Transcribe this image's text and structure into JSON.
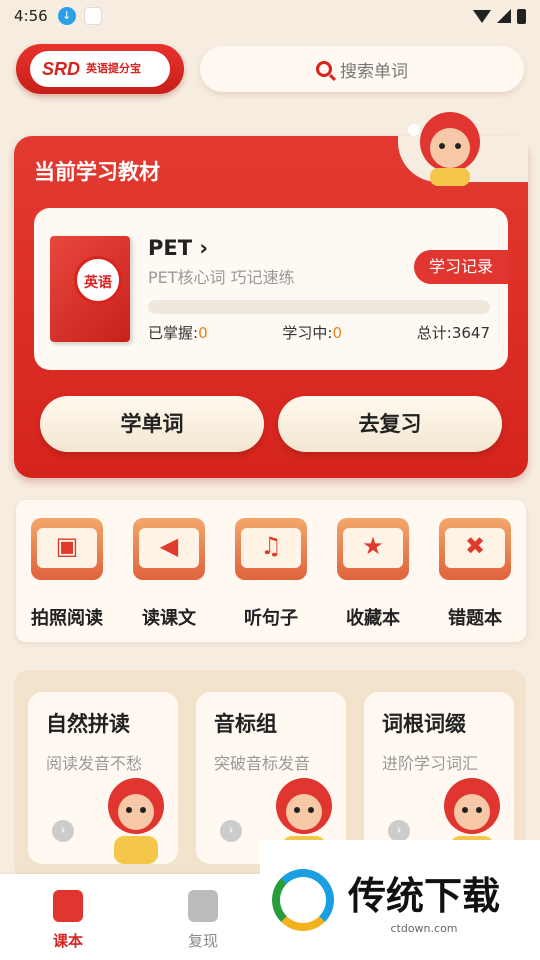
{
  "status": {
    "time": "4:56"
  },
  "logo": {
    "brand": "SRD",
    "name": "英语提分宝"
  },
  "search": {
    "placeholder": "搜索单词"
  },
  "study": {
    "title": "当前学习教材",
    "book_cover_badge": "英语",
    "book_name": "PET",
    "book_desc": "PET核心词 巧记速练",
    "record_button": "学习记录",
    "mastered_label": "已掌握:",
    "mastered_value": "0",
    "learning_label": "学习中:",
    "learning_value": "0",
    "total_label": "总计:",
    "total_value": "3647",
    "progress_fraction": 0
  },
  "buttons": {
    "study": "学单词",
    "review": "去复习"
  },
  "features": [
    {
      "label": "拍照阅读",
      "icon": "camera-icon"
    },
    {
      "label": "读课文",
      "icon": "megaphone-icon"
    },
    {
      "label": "听句子",
      "icon": "headphones-icon"
    },
    {
      "label": "收藏本",
      "icon": "star-icon"
    },
    {
      "label": "错题本",
      "icon": "x-mark-icon"
    }
  ],
  "cards": [
    {
      "title": "自然拼读",
      "desc": "阅读发音不愁"
    },
    {
      "title": "音标组",
      "desc": "突破音标发音"
    },
    {
      "title": "词根词缀",
      "desc": "进阶学习词汇"
    }
  ],
  "tabs": [
    {
      "label": "课本"
    },
    {
      "label": "复现"
    }
  ],
  "watermark": {
    "title": "传统下载",
    "url": "ctdown.com"
  },
  "colors": {
    "accent": "#d8231e",
    "background": "#f6ece0"
  }
}
